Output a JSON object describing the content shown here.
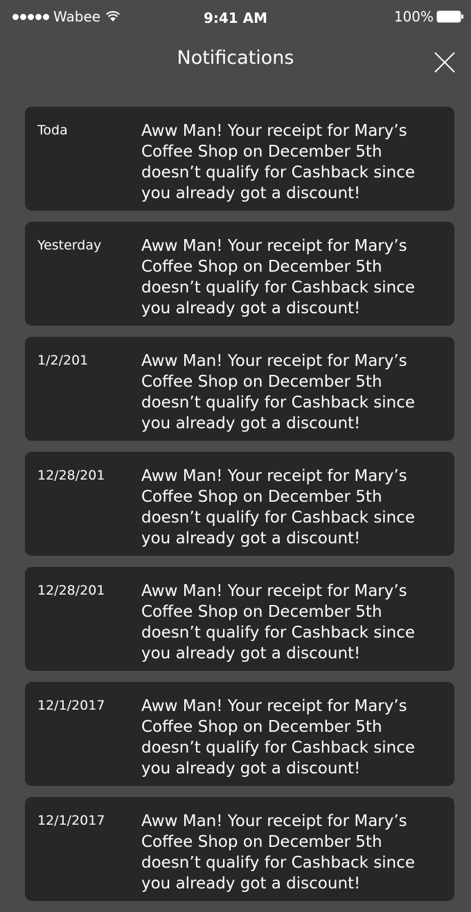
{
  "status_bar": {
    "carrier": "Wabee",
    "time": "9:41 AM",
    "battery": "100%"
  },
  "header": {
    "title": "Notifications",
    "close_icon": "close-icon"
  },
  "notifications": [
    {
      "date": "Toda",
      "message": "Aww Man! Your receipt for Mary’s Coffee Shop on December 5th doesn’t qualify for Cashback since you already got a discount!"
    },
    {
      "date": "Yesterday",
      "message": "Aww Man! Your receipt for Mary’s Coffee Shop on December 5th doesn’t qualify for Cashback since you already got a discount!"
    },
    {
      "date": "1/2/201",
      "message": "Aww Man! Your receipt for Mary’s Coffee Shop on December 5th doesn’t qualify for Cashback since you already got a discount!"
    },
    {
      "date": "12/28/201",
      "message": "Aww Man! Your receipt for Mary’s Coffee Shop on December 5th doesn’t qualify for Cashback since you already got a discount!"
    },
    {
      "date": "12/28/201",
      "message": "Aww Man! Your receipt for Mary’s Coffee Shop on December 5th doesn’t qualify for Cashback since you already got a discount!"
    },
    {
      "date": "12/1/2017",
      "message": "Aww Man! Your receipt for Mary’s Coffee Shop on December 5th doesn’t qualify for Cashback since you already got a discount!"
    },
    {
      "date": "12/1/2017",
      "message": "Aww Man! Your receipt for Mary’s Coffee Shop on December 5th doesn’t qualify for Cashback since you already got a discount!"
    }
  ],
  "colors": {
    "background": "#4a4a4a",
    "card": "#272727",
    "text": "#ffffff"
  }
}
